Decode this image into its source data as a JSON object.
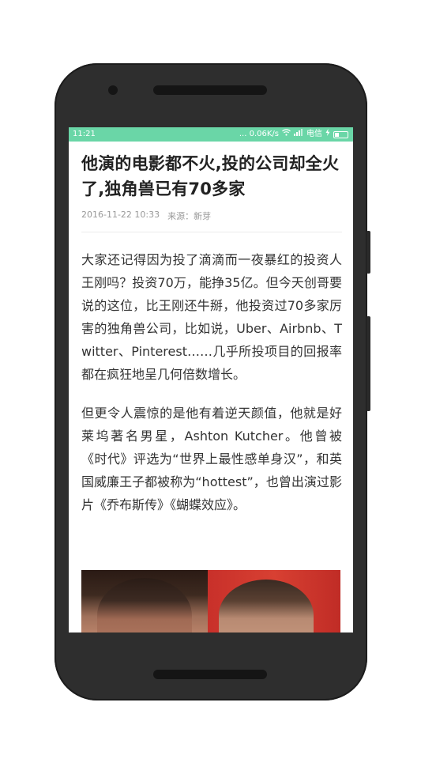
{
  "status_bar": {
    "time": "11:21",
    "speed": "... 0.06K/s",
    "carrier": "电信",
    "wifi_icon": "wifi-icon",
    "signal_icon": "signal-icon",
    "charging_icon": "charging-icon",
    "battery_icon": "battery-icon",
    "color": "#6ad6a7"
  },
  "article": {
    "title": "他演的电影都不火,投的公司却全火了,独角兽已有70多家",
    "date": "2016-11-22 10:33",
    "source": "来源：新芽",
    "paragraphs": [
      "大家还记得因为投了滴滴而一夜暴红的投资人王刚吗？投资70万，能挣35亿。但今天创哥要说的这位，比王刚还牛掰，他投资过70多家厉害的独角兽公司，比如说，Uber、Airbnb、Twitter、Pinterest……几乎所投项目的回报率都在疯狂地呈几何倍数增长。",
      "但更令人震惊的是他有着逆天颜值，他就是好莱坞著名男星，Ashton Kutcher。他曾被《时代》评选为“世界上最性感单身汉”，和英国威廉王子都被称为“hottest”，也曾出演过影片《乔布斯传》《蝴蝶效应》。"
    ]
  }
}
